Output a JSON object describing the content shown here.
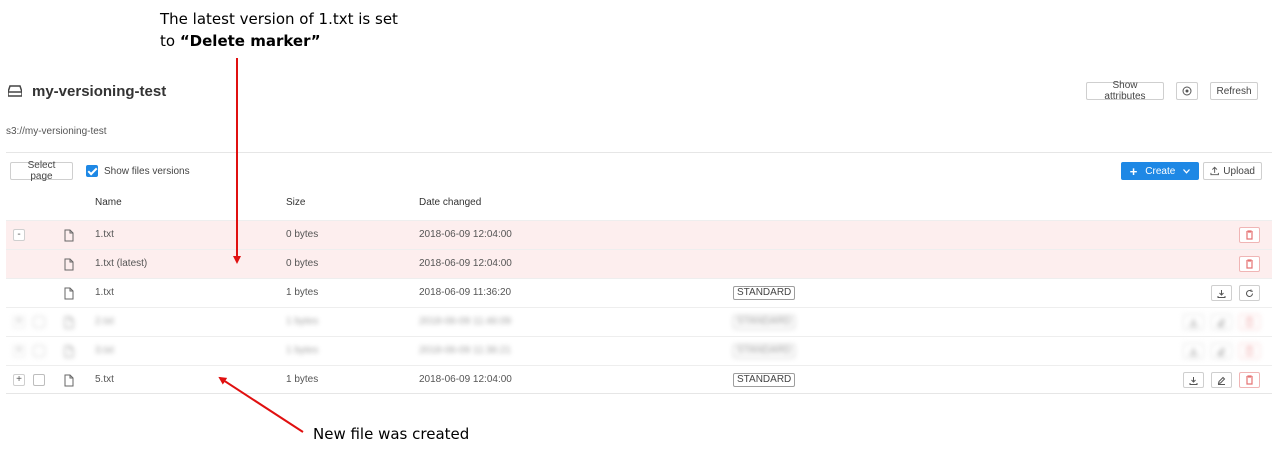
{
  "annotations": {
    "top_line1": "The latest version of 1.txt is set",
    "top_line2_prefix": "to ",
    "top_line2_bold": "“Delete marker”",
    "bottom": "New file was created"
  },
  "header": {
    "title": "my-versioning-test",
    "path": "s3://my-versioning-test",
    "show_attributes": "Show attributes",
    "refresh": "Refresh"
  },
  "toolbar": {
    "select_page": "Select page",
    "show_versions": "Show files versions",
    "create": "Create",
    "upload": "Upload"
  },
  "columns": {
    "name": "Name",
    "size": "Size",
    "date": "Date changed"
  },
  "rows": [
    {
      "expand": "-",
      "name": "1.txt",
      "size": "0 bytes",
      "date": "2018-06-09 12:04:00",
      "storage": ""
    },
    {
      "expand": "",
      "name": "1.txt (latest)",
      "size": "0 bytes",
      "date": "2018-06-09 12:04:00",
      "storage": ""
    },
    {
      "expand": "",
      "name": "1.txt",
      "size": "1 bytes",
      "date": "2018-06-09 11:36:20",
      "storage": "STANDARD"
    },
    {
      "expand": "+",
      "name": "2.txt",
      "size": "1 bytes",
      "date": "2018-06-09 11:46:09",
      "storage": "STANDARD"
    },
    {
      "expand": "+",
      "name": "3.txt",
      "size": "1 bytes",
      "date": "2018-06-09 11:36:21",
      "storage": "STANDARD"
    },
    {
      "expand": "+",
      "name": "5.txt",
      "size": "1 bytes",
      "date": "2018-06-09 12:04:00",
      "storage": "STANDARD"
    }
  ],
  "colors": {
    "accent": "#1e88e5",
    "delete_row": "#fdeeee",
    "arrow": "#e01010",
    "delete_icon": "#e57373"
  }
}
